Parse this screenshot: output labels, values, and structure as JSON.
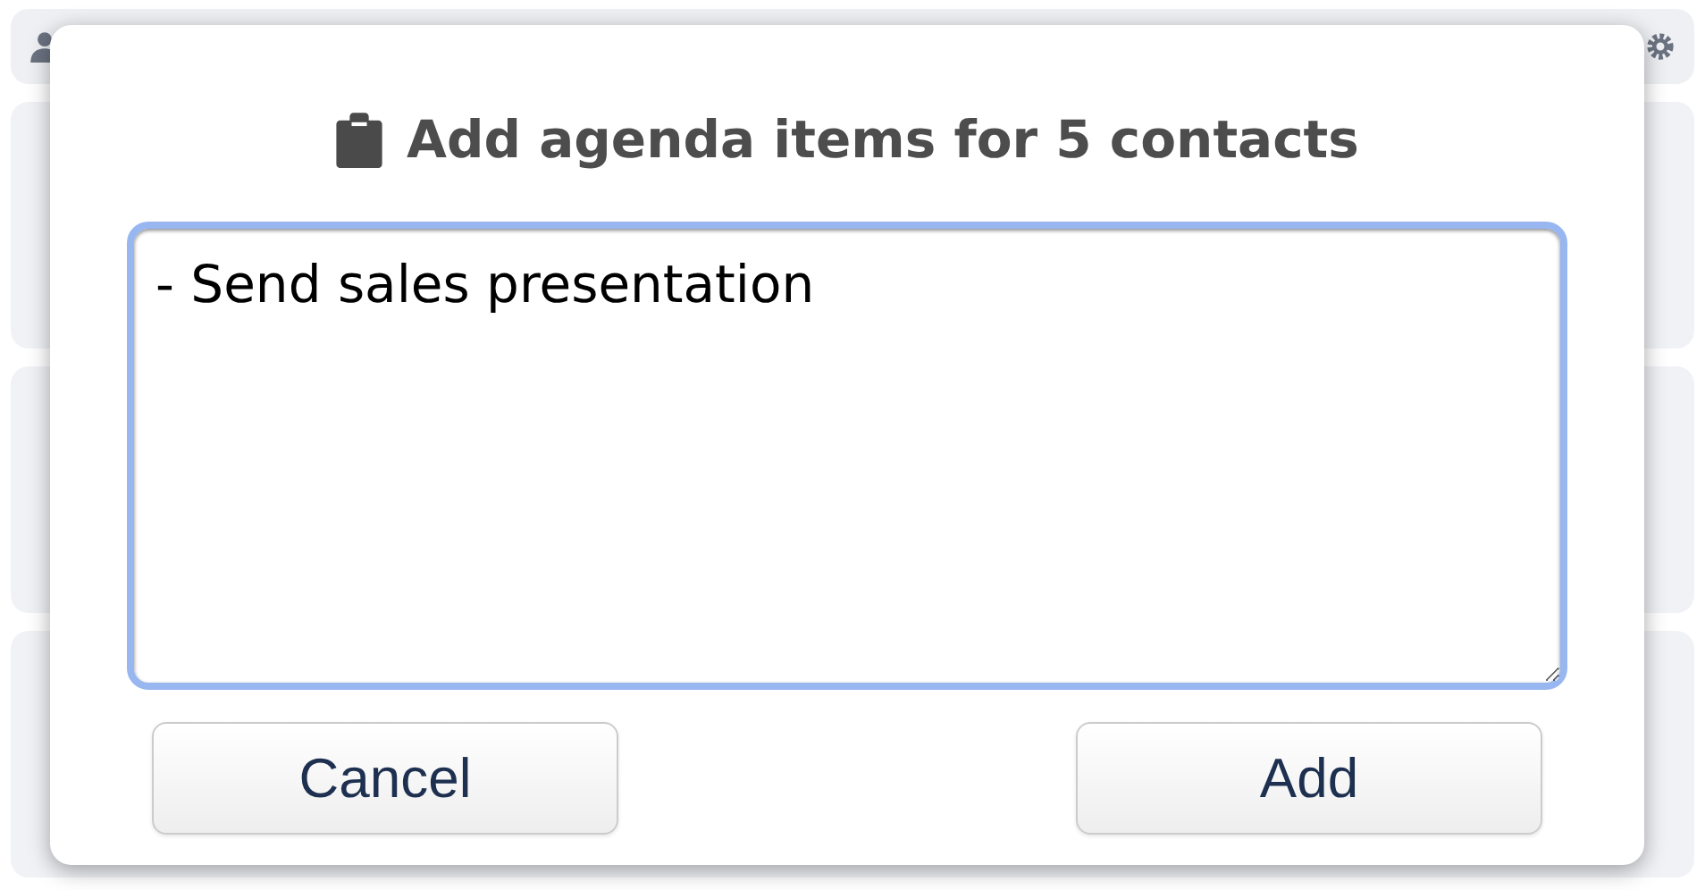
{
  "dialog": {
    "title": "Add agenda items for 5 contacts",
    "agenda": {
      "value": "- Send sales presentation"
    },
    "buttons": [
      {
        "label": "Cancel"
      },
      {
        "label": "Add"
      }
    ]
  }
}
